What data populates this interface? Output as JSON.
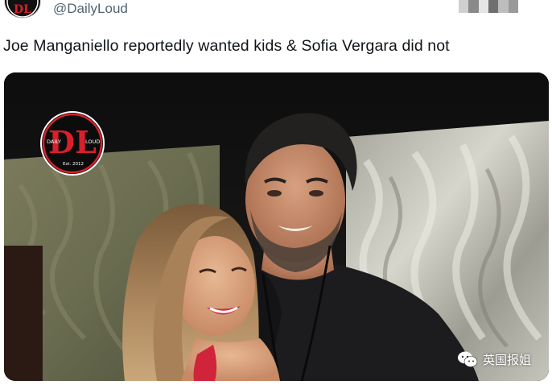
{
  "tweet": {
    "handle": "@DailyLoud",
    "text": "Joe Manganiello reportedly wanted kids & Sofia Vergara did not"
  },
  "media": {
    "logo": {
      "left_word": "DAILY",
      "right_word": "LOUD",
      "est": "Est. 2012"
    },
    "watermark": "英国报姐"
  },
  "colors": {
    "handle": "#536471",
    "text": "#0f1419",
    "logo_red": "#d8202a"
  }
}
